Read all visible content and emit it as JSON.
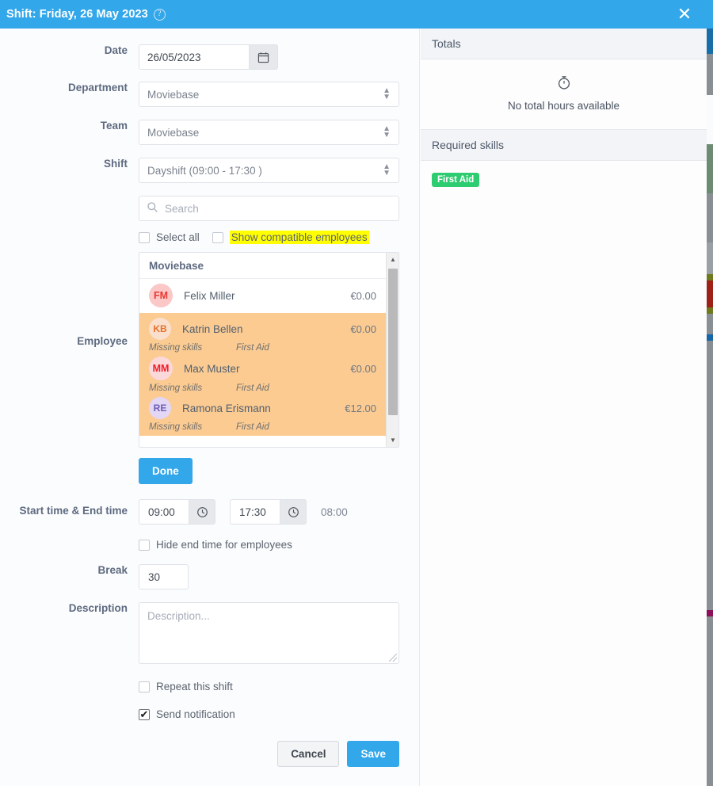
{
  "titlebar": {
    "title": "Shift: Friday, 26 May 2023",
    "help_icon": "question-circle-icon",
    "close_icon": "close-icon",
    "accent_color": "#32a7ea"
  },
  "form": {
    "date": {
      "label": "Date",
      "value": "26/05/2023",
      "icon": "calendar-icon"
    },
    "department": {
      "label": "Department",
      "value": "Moviebase"
    },
    "team": {
      "label": "Team",
      "value": "Moviebase"
    },
    "shift": {
      "label": "Shift",
      "value": "Dayshift (09:00 - 17:30 )"
    },
    "employee": {
      "label": "Employee",
      "search_placeholder": "Search",
      "search_value": "",
      "search_icon": "search-icon",
      "select_all_label": "Select all",
      "select_all_checked": false,
      "show_compatible_label": "Show compatible employees",
      "show_compatible_checked": false,
      "show_compatible_highlight": "#ffff00",
      "group_label": "Moviebase",
      "missing_skills_label": "Missing skills",
      "selected_row_color": "#fbcb92",
      "rows": [
        {
          "initials": "FM",
          "name": "Felix Miller",
          "cost": "€0.00",
          "avatar_bg": "#fbc7c7",
          "avatar_fg": "#e8392f",
          "selected": false,
          "missing_skill": ""
        },
        {
          "initials": "KB",
          "name": "Katrin Bellen",
          "cost": "€0.00",
          "avatar_bg": "#fae0cc",
          "avatar_fg": "#e8702a",
          "selected": true,
          "missing_skill": "First Aid"
        },
        {
          "initials": "MM",
          "name": "Max Muster",
          "cost": "€0.00",
          "avatar_bg": "#fbd8da",
          "avatar_fg": "#f01d28",
          "selected": true,
          "missing_skill": "First Aid"
        },
        {
          "initials": "RE",
          "name": "Ramona Erismann",
          "cost": "€12.00",
          "avatar_bg": "#e3d7f5",
          "avatar_fg": "#6a5bb5",
          "selected": true,
          "missing_skill": "First Aid"
        }
      ],
      "done_label": "Done",
      "scrollbar_up_icon": "chevron-up-icon",
      "scrollbar_down_icon": "chevron-down-icon"
    },
    "times": {
      "label": "Start time & End time",
      "start_value": "09:00",
      "end_value": "17:30",
      "duration": "08:00",
      "clock_icon": "clock-icon",
      "hide_end_time_label": "Hide end time for employees",
      "hide_end_time_checked": false
    },
    "break": {
      "label": "Break",
      "value": "30"
    },
    "description": {
      "label": "Description",
      "value": "",
      "placeholder": "Description..."
    },
    "repeat": {
      "label": "Repeat this shift",
      "checked": false
    },
    "notify": {
      "label": "Send notification",
      "checked": true,
      "tick": "✔"
    }
  },
  "footer": {
    "cancel_label": "Cancel",
    "save_label": "Save"
  },
  "side": {
    "totals": {
      "heading": "Totals",
      "icon": "stopwatch-icon",
      "empty_text": "No total hours available"
    },
    "required_skills": {
      "heading": "Required skills",
      "tags": [
        {
          "label": "First Aid",
          "color": "#2ecc71"
        }
      ]
    }
  }
}
